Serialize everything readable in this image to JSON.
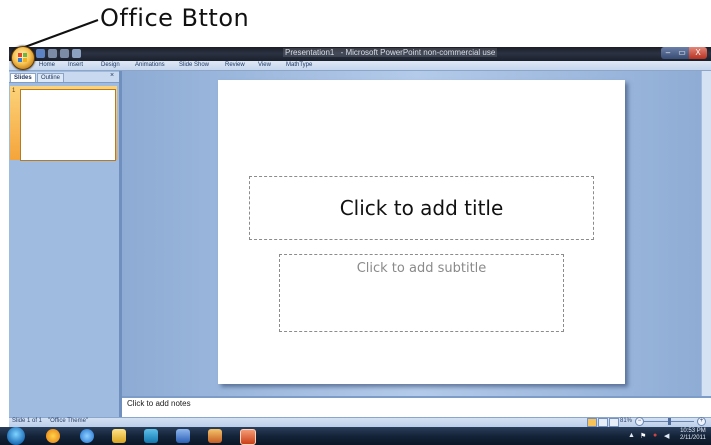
{
  "annotation": {
    "label": "Office Btton"
  },
  "window": {
    "title_doc": "Presentation1",
    "title_app": " - Microsoft PowerPoint non-commercial use",
    "controls": {
      "minimize": "–",
      "maximize": "▭",
      "close": "X"
    }
  },
  "ribbon": {
    "tabs": [
      "Home",
      "Insert",
      "Design",
      "Animations",
      "Slide Show",
      "Review",
      "View",
      "MathType"
    ]
  },
  "left_pane": {
    "tabs": [
      "Slides",
      "Outline"
    ],
    "close": "×",
    "thumbnail_number": "1"
  },
  "slide": {
    "title_placeholder": "Click to add title",
    "subtitle_placeholder": "Click to add subtitle"
  },
  "notes": {
    "placeholder": "Click to add notes"
  },
  "statusbar": {
    "slide_info": "Slide 1 of 1",
    "theme": "\"Office Theme\"",
    "zoom": "81%",
    "zoom_minus": "−",
    "zoom_plus": "+"
  },
  "taskbar": {
    "time": "10:53 PM",
    "date": "2/11/2011",
    "icons": [
      "start-orb-icon",
      "media-player-icon",
      "internet-explorer-icon",
      "file-explorer-icon",
      "media-center-icon",
      "word-icon",
      "paint-icon",
      "powerpoint-icon"
    ]
  },
  "colors": {
    "workspace_blue": "#a9c2e4",
    "selection_orange": "#f5a43a",
    "titlebar_dark": "#1b1e26"
  }
}
